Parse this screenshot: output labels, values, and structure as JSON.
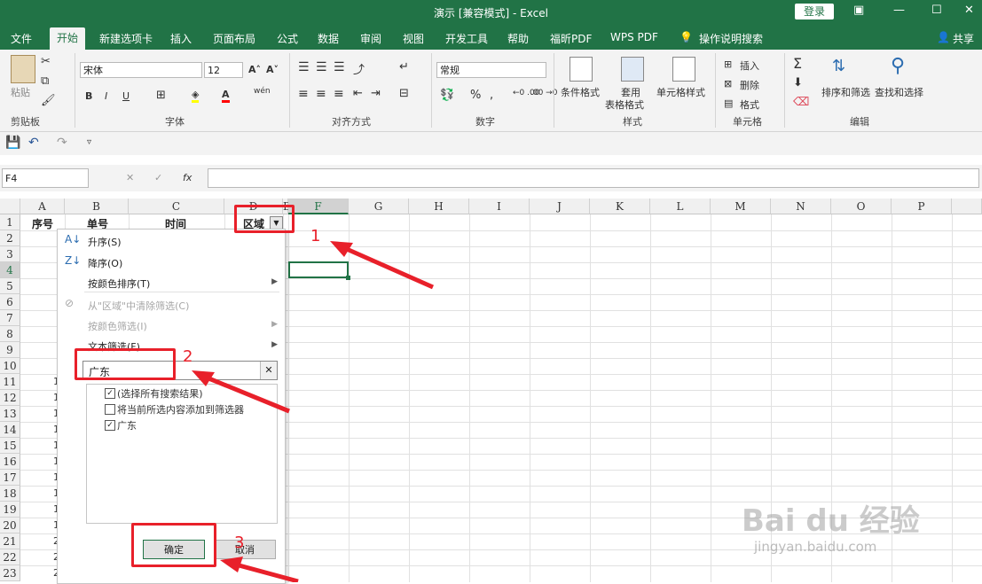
{
  "title": "演示 [兼容模式] - Excel",
  "login_label": "登录",
  "share_label": "共享",
  "tabs": [
    "文件",
    "开始",
    "新建选项卡",
    "插入",
    "页面布局",
    "公式",
    "数据",
    "审阅",
    "视图",
    "开发工具",
    "帮助",
    "福昕PDF",
    "WPS PDF",
    "操作说明搜索"
  ],
  "ribbon": {
    "paste": "粘贴",
    "font_name": "宋体",
    "font_size": "12",
    "wen": "wén",
    "number_format": "常规",
    "percent": "%",
    "dec_inc": "←0 .00",
    "dec_dec": ".00 →0",
    "cond_format": "条件格式",
    "table_format_1": "套用",
    "table_format_2": "表格格式",
    "cell_style": "单元格样式",
    "insert": "插入",
    "delete": "删除",
    "format": "格式",
    "sort_filter": "排序和筛选",
    "find_select": "查找和选择",
    "groups": [
      "剪贴板",
      "字体",
      "对齐方式",
      "数字",
      "样式",
      "单元格",
      "编辑"
    ]
  },
  "name_box": "F4",
  "fx_label": "fx",
  "columns": [
    "A",
    "B",
    "C",
    "D",
    "E",
    "F",
    "G",
    "H",
    "I",
    "J",
    "K",
    "L",
    "M",
    "N",
    "O",
    "P"
  ],
  "rows": [
    "1",
    "2",
    "3",
    "4",
    "5",
    "6",
    "7",
    "8",
    "9",
    "10",
    "11",
    "12",
    "13",
    "14",
    "15",
    "16",
    "17",
    "18",
    "19",
    "20",
    "21",
    "22",
    "23"
  ],
  "header_cells": {
    "a1": "序号",
    "b1": "单号",
    "c1": "时间",
    "d1": "区域"
  },
  "a_column_partial": [
    "1",
    "1",
    "1",
    "1",
    "1",
    "1",
    "1",
    "1",
    "1",
    "1",
    "2",
    "2",
    "2"
  ],
  "menu": {
    "sort_asc": "升序(S)",
    "sort_desc": "降序(O)",
    "sort_color": "按颜色排序(T)",
    "clear_filter": "从\"区域\"中清除筛选(C)",
    "filter_color": "按颜色筛选(I)",
    "text_filter": "文本筛选(F)",
    "search_value": "广东",
    "clear_x": "✕",
    "opt_select_all": "(选择所有搜索结果)",
    "opt_add_current": "将当前所选内容添加到筛选器",
    "opt_guangdong": "广东",
    "ok": "确定",
    "cancel": "取消"
  },
  "annotations": [
    "1",
    "2",
    "3"
  ],
  "watermark": {
    "brand": "Bai du 经验",
    "url": "jingyan.baidu.com"
  }
}
